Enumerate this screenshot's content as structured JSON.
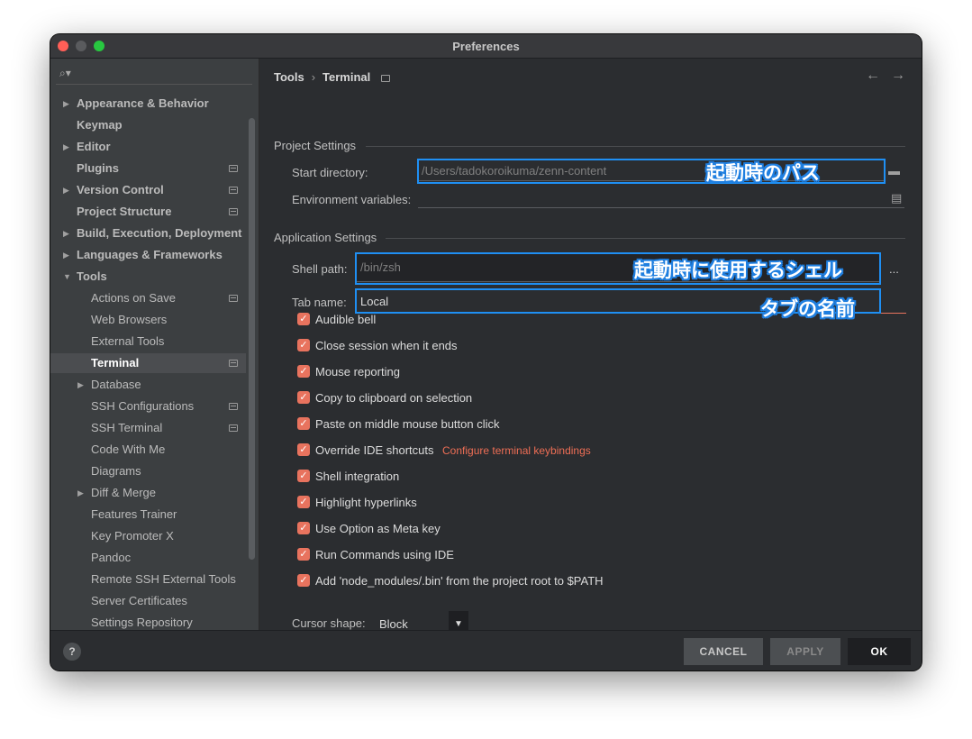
{
  "window": {
    "title": "Preferences"
  },
  "sidebar": {
    "search_placeholder": "",
    "items": [
      {
        "label": "Appearance & Behavior",
        "level": 0,
        "arrow": "▶",
        "badge": false,
        "bold": true
      },
      {
        "label": "Keymap",
        "level": 0,
        "arrow": "",
        "badge": false,
        "bold": true
      },
      {
        "label": "Editor",
        "level": 0,
        "arrow": "▶",
        "badge": false,
        "bold": true
      },
      {
        "label": "Plugins",
        "level": 0,
        "arrow": "",
        "badge": true,
        "bold": true
      },
      {
        "label": "Version Control",
        "level": 0,
        "arrow": "▶",
        "badge": true,
        "bold": true
      },
      {
        "label": "Project Structure",
        "level": 0,
        "arrow": "",
        "badge": true,
        "bold": true
      },
      {
        "label": "Build, Execution, Deployment",
        "level": 0,
        "arrow": "▶",
        "badge": false,
        "bold": true
      },
      {
        "label": "Languages & Frameworks",
        "level": 0,
        "arrow": "▶",
        "badge": false,
        "bold": true
      },
      {
        "label": "Tools",
        "level": 0,
        "arrow": "▼",
        "badge": false,
        "bold": true
      },
      {
        "label": "Actions on Save",
        "level": 1,
        "arrow": "",
        "badge": true,
        "bold": false
      },
      {
        "label": "Web Browsers",
        "level": 1,
        "arrow": "",
        "badge": false,
        "bold": false
      },
      {
        "label": "External Tools",
        "level": 1,
        "arrow": "",
        "badge": false,
        "bold": false
      },
      {
        "label": "Terminal",
        "level": 1,
        "arrow": "",
        "badge": true,
        "bold": false,
        "selected": true
      },
      {
        "label": "Database",
        "level": 1,
        "arrow": "▶",
        "badge": false,
        "bold": false
      },
      {
        "label": "SSH Configurations",
        "level": 1,
        "arrow": "",
        "badge": true,
        "bold": false
      },
      {
        "label": "SSH Terminal",
        "level": 1,
        "arrow": "",
        "badge": true,
        "bold": false
      },
      {
        "label": "Code With Me",
        "level": 1,
        "arrow": "",
        "badge": false,
        "bold": false
      },
      {
        "label": "Diagrams",
        "level": 1,
        "arrow": "",
        "badge": false,
        "bold": false
      },
      {
        "label": "Diff & Merge",
        "level": 1,
        "arrow": "▶",
        "badge": false,
        "bold": false
      },
      {
        "label": "Features Trainer",
        "level": 1,
        "arrow": "",
        "badge": false,
        "bold": false
      },
      {
        "label": "Key Promoter X",
        "level": 1,
        "arrow": "",
        "badge": false,
        "bold": false
      },
      {
        "label": "Pandoc",
        "level": 1,
        "arrow": "",
        "badge": false,
        "bold": false
      },
      {
        "label": "Remote SSH External Tools",
        "level": 1,
        "arrow": "",
        "badge": false,
        "bold": false
      },
      {
        "label": "Server Certificates",
        "level": 1,
        "arrow": "",
        "badge": false,
        "bold": false
      },
      {
        "label": "Settings Repository",
        "level": 1,
        "arrow": "",
        "badge": false,
        "bold": false
      }
    ]
  },
  "breadcrumb": {
    "parent": "Tools",
    "separator": "›",
    "current": "Terminal"
  },
  "nav": {
    "back": "←",
    "forward": "→"
  },
  "project_settings": {
    "title": "Project Settings",
    "start_directory_label": "Start directory:",
    "start_directory_value": "/Users/tadokoroikuma/zenn-content",
    "env_vars_label": "Environment variables:",
    "env_vars_value": ""
  },
  "application_settings": {
    "title": "Application Settings",
    "shell_path_label": "Shell path:",
    "shell_path_value": "/bin/zsh",
    "shell_browse": "...",
    "tab_name_label": "Tab name:",
    "tab_name_value": "Local"
  },
  "annotations": {
    "start_dir": "起動時のパス",
    "shell": "起動時に使用するシェル",
    "tab_name": "タブの名前"
  },
  "checkboxes": [
    {
      "label": "Audible bell",
      "checked": true
    },
    {
      "label": "Close session when it ends",
      "checked": true
    },
    {
      "label": "Mouse reporting",
      "checked": true
    },
    {
      "label": "Copy to clipboard on selection",
      "checked": true
    },
    {
      "label": "Paste on middle mouse button click",
      "checked": true
    },
    {
      "label": "Override IDE shortcuts",
      "checked": true,
      "link": "Configure terminal keybindings"
    },
    {
      "label": "Shell integration",
      "checked": true
    },
    {
      "label": "Highlight hyperlinks",
      "checked": true
    },
    {
      "label": "Use Option as Meta key",
      "checked": true
    },
    {
      "label": "Run Commands using IDE",
      "checked": true
    },
    {
      "label": "Add 'node_modules/.bin' from the project root to $PATH",
      "checked": true
    }
  ],
  "cursor_shape": {
    "label": "Cursor shape:",
    "value": "Block"
  },
  "footer": {
    "help": "?",
    "cancel": "CANCEL",
    "apply": "APPLY",
    "ok": "OK"
  },
  "colors": {
    "accent": "#e8735e",
    "highlight": "#1f8ff3",
    "background": "#2b2d30",
    "sidebar": "#3c3f41"
  }
}
